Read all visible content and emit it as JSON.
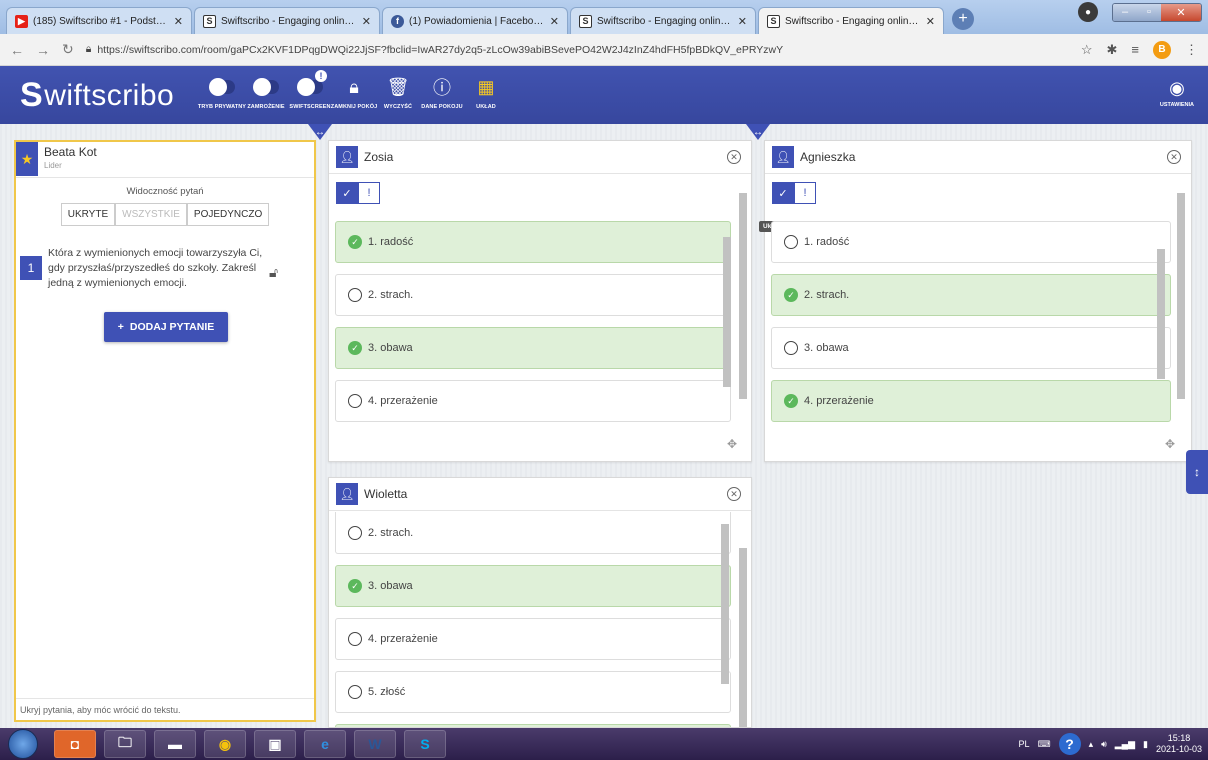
{
  "browser": {
    "tabs": [
      {
        "title": "(185) Swiftscribo #1 - Podstawy -",
        "favicon": "youtube-icon",
        "color": "#e62117"
      },
      {
        "title": "Swiftscribo - Engaging online cla",
        "favicon": "swiftscribo-icon",
        "color": "#ffffff"
      },
      {
        "title": "(1) Powiadomienia | Facebook",
        "favicon": "facebook-icon",
        "color": "#3b5998"
      },
      {
        "title": "Swiftscribo - Engaging online cla",
        "favicon": "swiftscribo-icon",
        "color": "#ffffff"
      },
      {
        "title": "Swiftscribo - Engaging online cla",
        "favicon": "swiftscribo-icon",
        "color": "#ffffff"
      }
    ],
    "url": "https://swiftscribo.com/room/gaPCx2KVF1DPqgDWQi22JjSF?fbclid=IwAR27dy2q5-zLcOw39abiBSevePO42W2J4zInZ4hdFH5fpBDkQV_ePRYzwY",
    "profile_initial": "B"
  },
  "app": {
    "logo_text": "wiftscribo",
    "logo_letter": "S",
    "brand_color": "#3f51b5",
    "toolbar": [
      {
        "label": "TRYB PRYWATNY",
        "icon": "toggle-icon"
      },
      {
        "label": "ZAMROŻENIE",
        "icon": "toggle-icon"
      },
      {
        "label": "SWIFTSCREEN",
        "icon": "toggle-icon"
      },
      {
        "label": "ZAMKNIJ POKÓJ",
        "icon": "lock-icon"
      },
      {
        "label": "WYCZYŚĆ",
        "icon": "trash-icon"
      },
      {
        "label": "DANE POKOJU",
        "icon": "info-icon"
      },
      {
        "label": "UKŁAD",
        "icon": "grid-icon"
      }
    ],
    "settings_label": "USTAWIENIA"
  },
  "leader": {
    "name": "Beata Kot",
    "role": "Lider",
    "visibility_label": "Widoczność pytań",
    "visibility_options": [
      "UKRYTE",
      "WSZYSTKIE",
      "POJEDYNCZO"
    ],
    "question_number": "1",
    "question_text": "Która z wymienionych emocji towarzyszyła Ci, gdy przyszłaś/przyszedłeś do szkoły. Zakreśl jedną z wymienionych emocji.",
    "add_question_label": "DODAJ PYTANIE",
    "footer": "Ukryj pytania, aby móc wrócić do tekstu."
  },
  "students": [
    {
      "name": "Zosia",
      "answers": [
        {
          "text": "1. radość",
          "checked": true
        },
        {
          "text": "2. strach.",
          "checked": false
        },
        {
          "text": "3. obawa",
          "checked": true
        },
        {
          "text": "4. przerażenie",
          "checked": false
        }
      ]
    },
    {
      "name": "Agnieszka",
      "tooltip": "Ukryj odpowiedź",
      "answers": [
        {
          "text": "1. radość",
          "checked": false
        },
        {
          "text": "2. strach.",
          "checked": true
        },
        {
          "text": "3. obawa",
          "checked": false
        },
        {
          "text": "4. przerażenie",
          "checked": true
        }
      ]
    },
    {
      "name": "Wioletta",
      "answers": [
        {
          "text": "2. strach.",
          "checked": false
        },
        {
          "text": "3. obawa",
          "checked": true
        },
        {
          "text": "4. przerażenie",
          "checked": false
        },
        {
          "text": "5. złość",
          "checked": false
        }
      ]
    }
  ],
  "taskbar": {
    "lang": "PL",
    "time": "15:18",
    "date": "2021-10-03"
  }
}
